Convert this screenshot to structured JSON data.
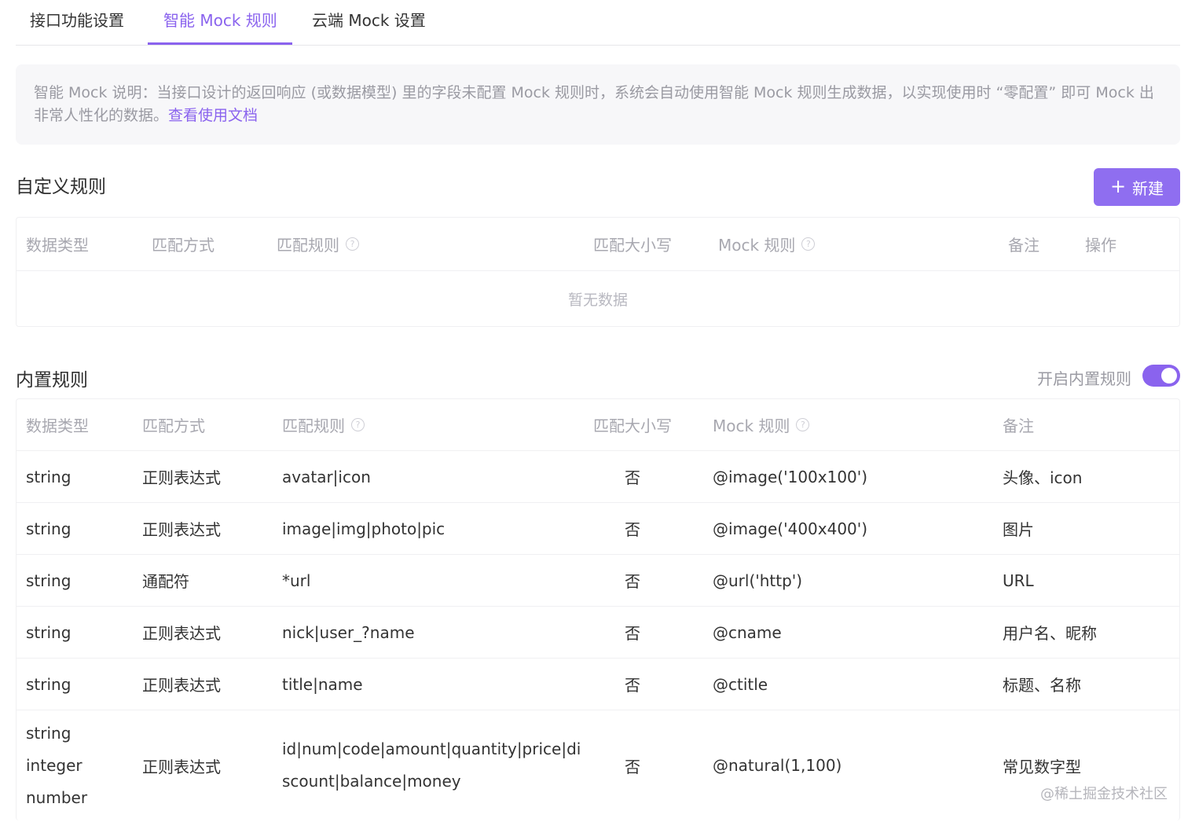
{
  "tabs": [
    {
      "label": "接口功能设置",
      "active": false
    },
    {
      "label": "智能 Mock 规则",
      "active": true
    },
    {
      "label": "云端 Mock 设置",
      "active": false
    }
  ],
  "info": {
    "text": "智能 Mock 说明：当接口设计的返回响应 (或数据模型) 里的字段未配置 Mock 规则时，系统会自动使用智能 Mock 规则生成数据，以实现使用时 “零配置” 即可 Mock 出非常人性化的数据。",
    "link": "查看使用文档"
  },
  "custom": {
    "title": "自定义规则",
    "new_button": "新建",
    "columns": [
      "数据类型",
      "匹配方式",
      "匹配规则",
      "匹配大小写",
      "Mock 规则",
      "备注",
      "操作"
    ],
    "empty_text": "暂无数据"
  },
  "builtin": {
    "title": "内置规则",
    "toggle_label": "开启内置规则",
    "toggle_on": true,
    "columns": [
      "数据类型",
      "匹配方式",
      "匹配规则",
      "匹配大小写",
      "Mock 规则",
      "备注"
    ],
    "rows": [
      {
        "type": "string",
        "method": "正则表达式",
        "rule": "avatar|icon",
        "case": "否",
        "mock": "@image('100x100')",
        "note": "头像、icon"
      },
      {
        "type": "string",
        "method": "正则表达式",
        "rule": "image|img|photo|pic",
        "case": "否",
        "mock": "@image('400x400')",
        "note": "图片"
      },
      {
        "type": "string",
        "method": "通配符",
        "rule": "*url",
        "case": "否",
        "mock": "@url('http')",
        "note": "URL"
      },
      {
        "type": "string",
        "method": "正则表达式",
        "rule": "nick|user_?name",
        "case": "否",
        "mock": "@cname",
        "note": "用户名、昵称"
      },
      {
        "type": "string",
        "method": "正则表达式",
        "rule": "title|name",
        "case": "否",
        "mock": "@ctitle",
        "note": "标题、名称"
      }
    ],
    "last_row": {
      "types": [
        "string",
        "integer",
        "number"
      ],
      "method": "正则表达式",
      "rule_lines": [
        "id|num|code|amount|quantity|price|di",
        "scount|balance|money"
      ],
      "case": "否",
      "mock": "@natural(1,100)",
      "note": "常见数字型"
    }
  },
  "watermark": "@稀土掘金技术社区"
}
